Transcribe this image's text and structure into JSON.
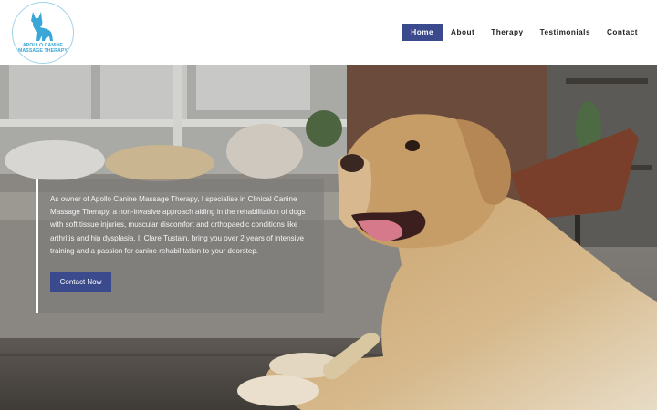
{
  "logo": {
    "line1": "APOLLO CANINE",
    "line2": "MASSAGE THERAPY",
    "icon": "dog-silhouette-icon"
  },
  "nav": {
    "items": [
      {
        "label": "Home",
        "active": true
      },
      {
        "label": "About",
        "active": false
      },
      {
        "label": "Therapy",
        "active": false
      },
      {
        "label": "Testimonials",
        "active": false
      },
      {
        "label": "Contact",
        "active": false
      }
    ]
  },
  "hero": {
    "intro": "As owner of Apollo Canine Massage Therapy, I specialise in Clinical Canine Massage Therapy, a non-invasive approach aiding in the rehabilitation of dogs with soft tissue injuries, muscular discomfort and orthopaedic conditions like arthritis and hip dysplasia. I, Clare Tustain, bring you over 2 years of intensive training and a passion for canine rehabilitation to your doorstep.",
    "cta_label": "Contact Now"
  },
  "colors": {
    "accent": "#3b4a8c",
    "logo_blue": "#3aa7d6",
    "overlay_border": "#ffffff"
  }
}
